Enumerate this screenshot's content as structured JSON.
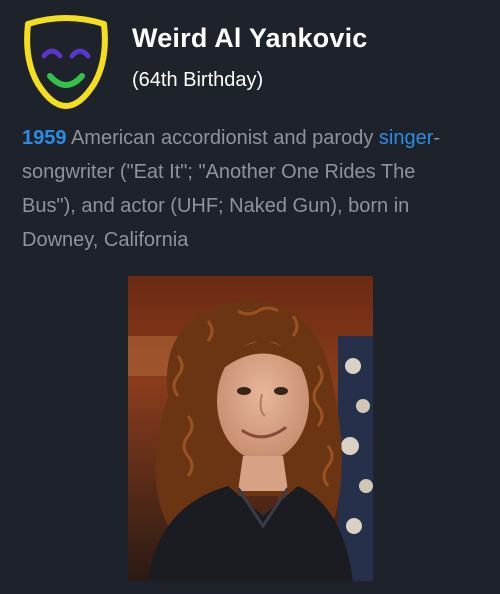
{
  "header": {
    "icon": "theater-mask-icon",
    "name": "Weird Al Yankovic",
    "subtitle": "(64th Birthday)"
  },
  "description": {
    "year": "1959",
    "text_1": " American accordionist and parody ",
    "link": "singer",
    "text_2": "-",
    "line_2": "songwriter (\"Eat It\"; \"Another One Rides The",
    "line_3": "Bus\"), and actor (UHF; Naked Gun), born in",
    "line_4": "Downey, California"
  },
  "photo": {
    "subject": "portrait-photo"
  },
  "colors": {
    "background": "#1e222a",
    "accent": "#2a8de4",
    "mask_outline": "#f3df1e",
    "mask_eyes": "#5b35c9",
    "mask_smile": "#33c14a"
  }
}
